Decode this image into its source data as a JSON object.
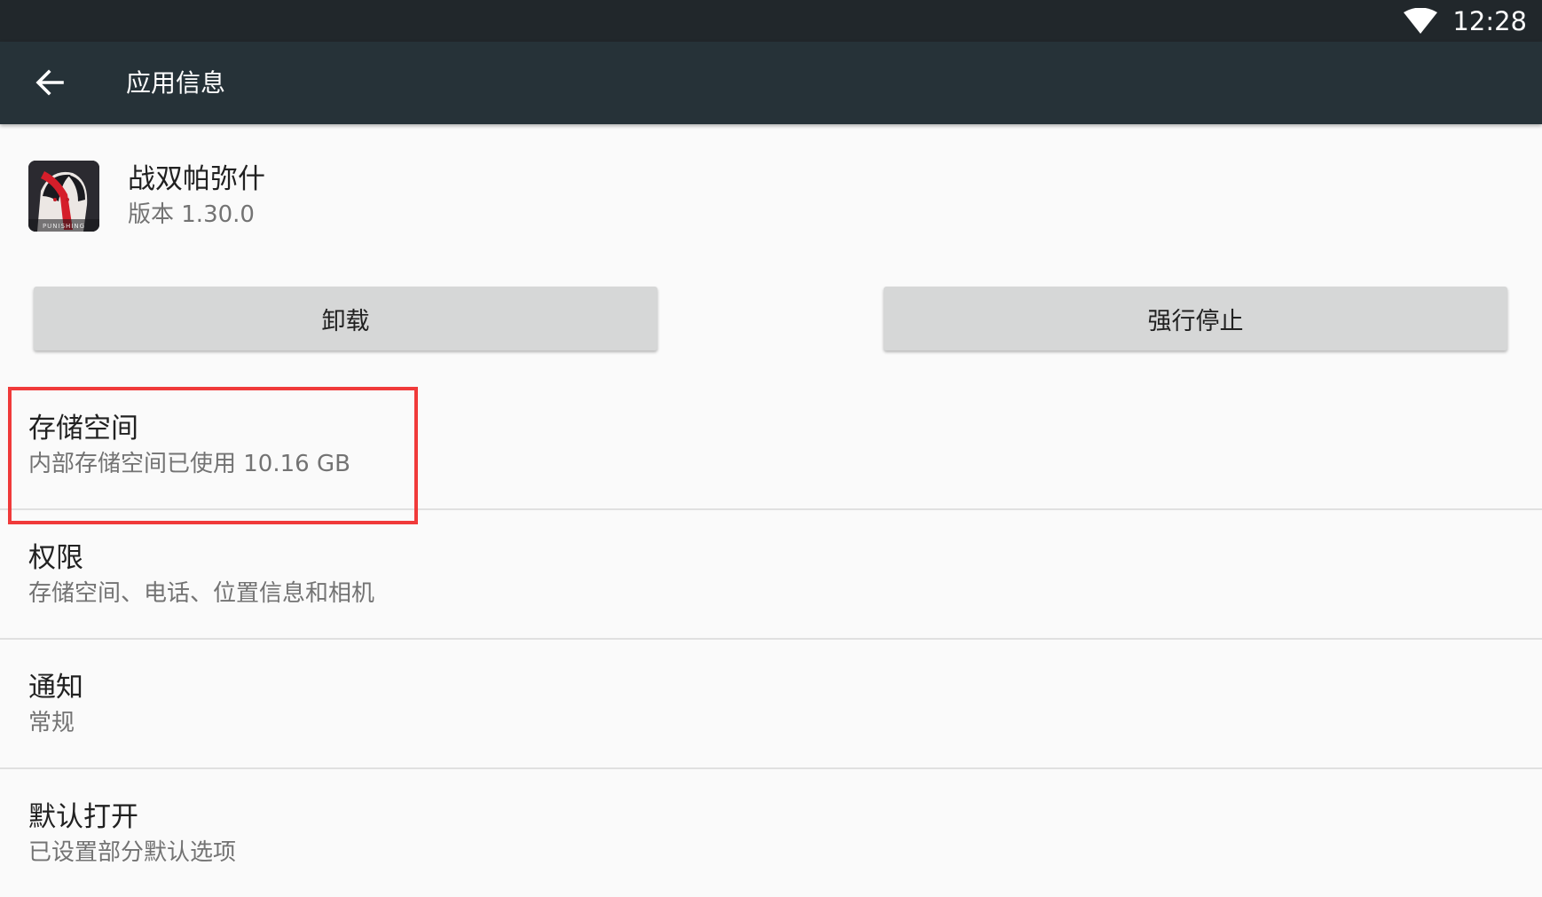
{
  "status_bar": {
    "time": "12:28",
    "wifi_icon": "wifi-icon"
  },
  "app_bar": {
    "back_icon": "arrow-left-icon",
    "title": "应用信息"
  },
  "app": {
    "name": "战双帕弥什",
    "version": "版本 1.30.0",
    "icon_text": "PUNISHING"
  },
  "buttons": {
    "uninstall": "卸载",
    "force_stop": "强行停止"
  },
  "settings": [
    {
      "title": "存储空间",
      "subtitle": "内部存储空间已使用 10.16 GB"
    },
    {
      "title": "权限",
      "subtitle": "存储空间、电话、位置信息和相机"
    },
    {
      "title": "通知",
      "subtitle": "常规"
    },
    {
      "title": "默认打开",
      "subtitle": "已设置部分默认选项"
    }
  ],
  "colors": {
    "status_bar": "#21272b",
    "app_bar": "#263238",
    "background": "#fafafa",
    "button": "#d6d7d7",
    "highlight": "#f03a3a"
  }
}
